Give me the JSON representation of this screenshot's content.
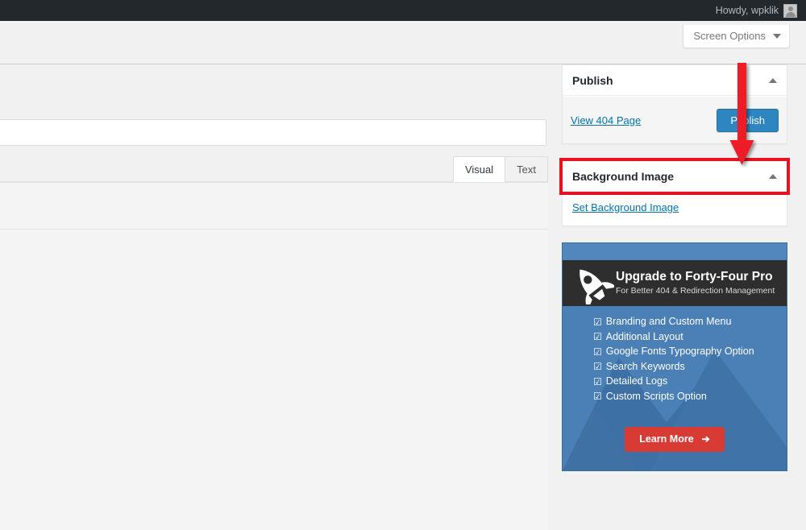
{
  "adminbar": {
    "greeting": "Howdy, wpklik",
    "avatar_icon": "user-avatar-icon"
  },
  "header": {
    "screen_options_label": "Screen Options",
    "screen_options_icon": "chevron-down-icon"
  },
  "editor": {
    "title_placeholder": "",
    "title_value": "",
    "tabs": [
      {
        "label": "Visual",
        "active": true
      },
      {
        "label": "Text",
        "active": false
      }
    ]
  },
  "sidebar": {
    "publish_box": {
      "title": "Publish",
      "toggle_icon": "chevron-up-icon",
      "view_link": "View 404 Page",
      "publish_button": "Publish"
    },
    "background_box": {
      "title": "Background Image",
      "toggle_icon": "chevron-up-icon",
      "set_link": "Set Background Image",
      "highlight_color": "#e81123"
    },
    "promo": {
      "heading": "Upgrade to Forty-Four Pro",
      "subheading": "For Better 404 & Redirection Management",
      "rocket_icon": "rocket-icon",
      "check_glyph": "☑",
      "features": [
        "Branding and Custom Menu",
        "Additional Layout",
        "Google Fonts Typography Option",
        "Search Keywords",
        "Detailed Logs",
        "Custom Scripts Option"
      ],
      "cta_label": "Learn More",
      "cta_icon": "arrow-right-icon",
      "cta_color": "#d83b34",
      "banner_color": "#4b80b6"
    }
  },
  "annotation": {
    "arrow_icon": "down-arrow-annotation",
    "arrow_color": "#ee1c25"
  }
}
